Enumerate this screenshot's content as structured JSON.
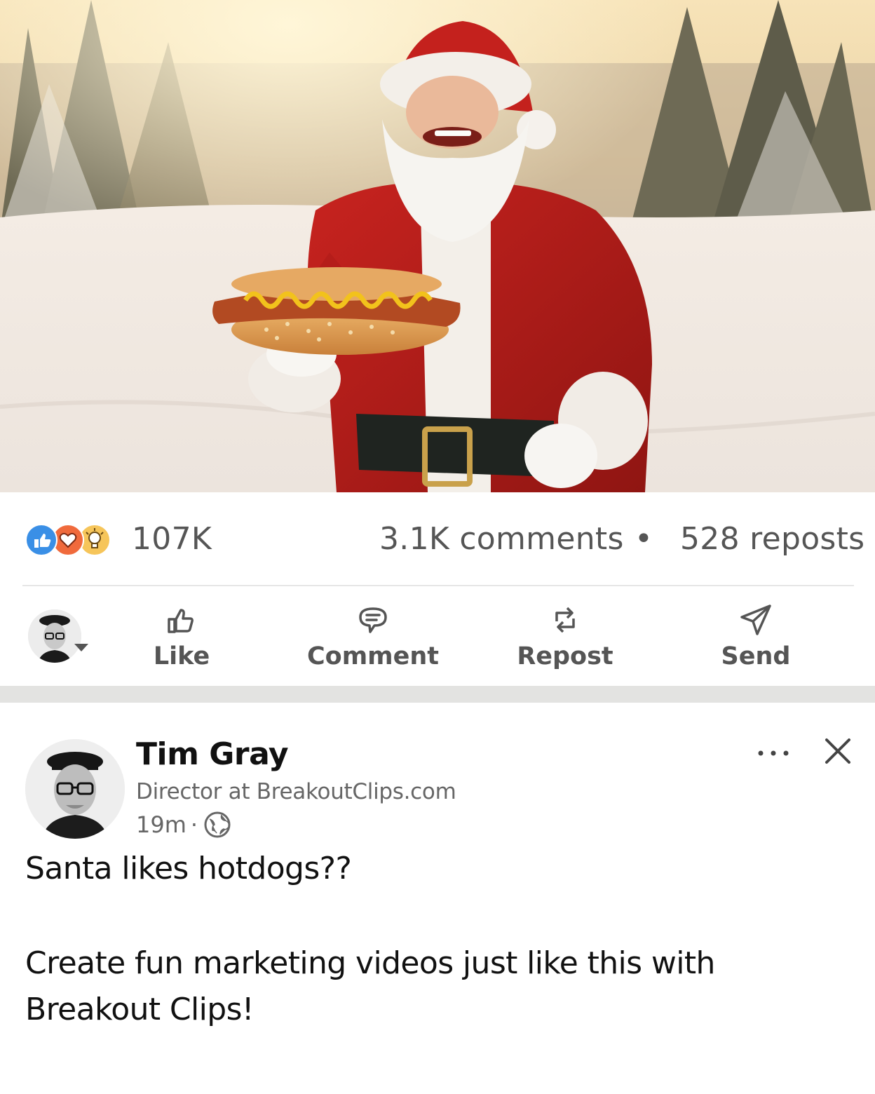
{
  "media": {
    "image_subject": "santa-with-hotdog-photo"
  },
  "social_counts": {
    "reaction_icons": [
      "like-reaction-icon",
      "love-reaction-icon",
      "insightful-reaction-icon"
    ],
    "reactions": "107K",
    "comments": "3.1K comments",
    "separator": "•",
    "reposts": "528 reposts"
  },
  "actions": {
    "like": "Like",
    "comment": "Comment",
    "repost": "Repost",
    "send": "Send"
  },
  "next_post": {
    "author_name": "Tim Gray",
    "author_title": "Director at BreakoutClips.com",
    "time": "19m",
    "time_separator": "·",
    "visibility_icon": "globe-icon",
    "text_line1": "Santa likes hotdogs??",
    "text_line2": "Create fun marketing videos just like this with Breakout Clips!",
    "menu_icon": "more-options-icon",
    "dismiss_icon": "close-icon"
  },
  "colors": {
    "like_blue": "#3a8fe6",
    "love_orange": "#f06a3c",
    "insight_yellow": "#f6c55a",
    "label_gray": "#555555",
    "band_gray": "#e3e3e1"
  }
}
